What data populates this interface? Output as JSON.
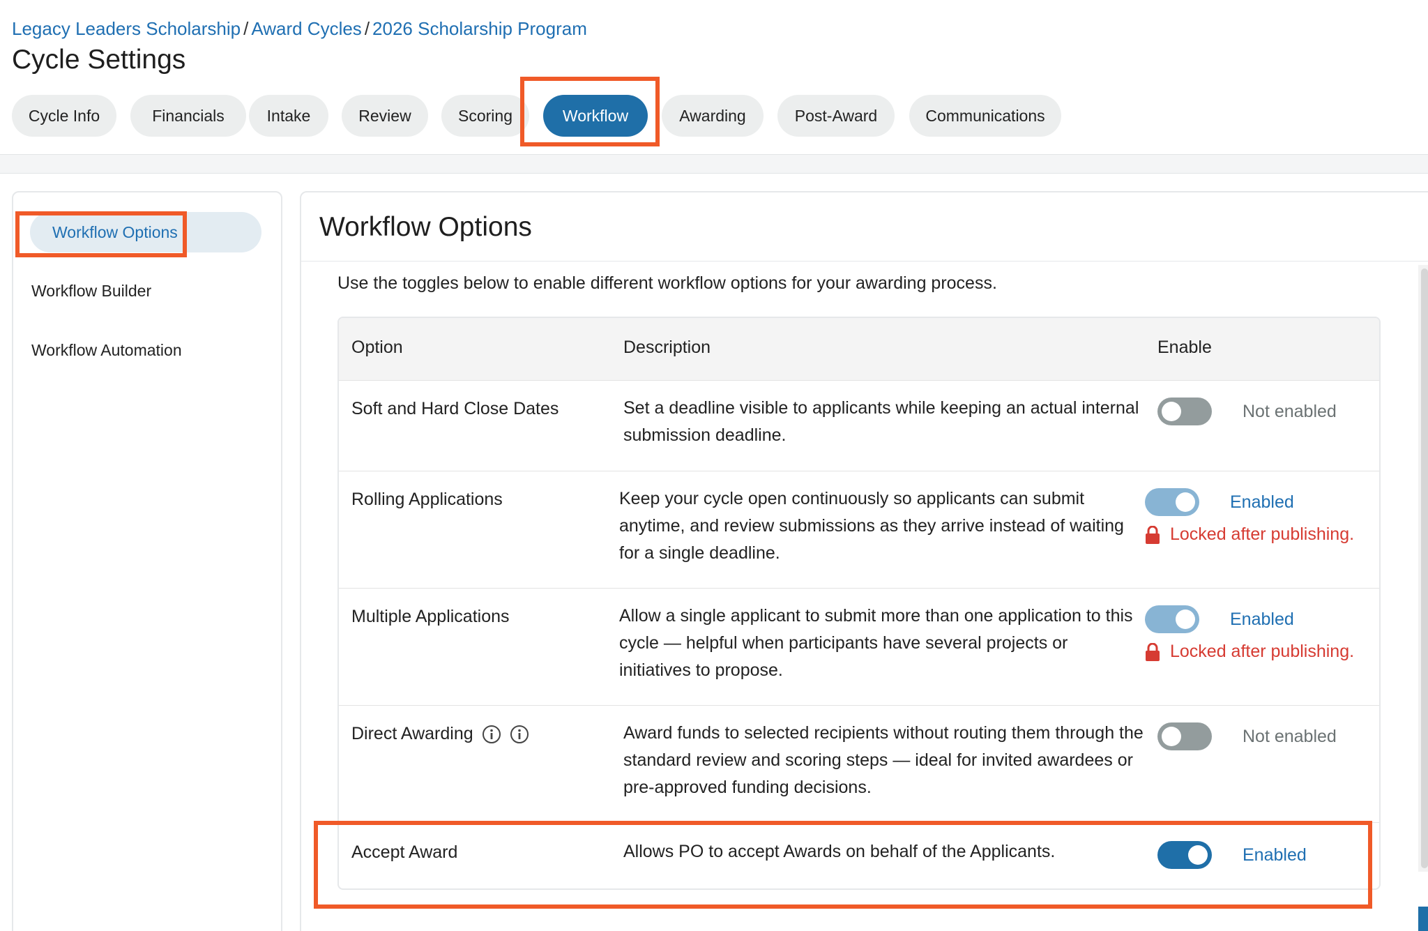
{
  "breadcrumb": {
    "items": [
      "Legacy Leaders Scholarship",
      "Award Cycles",
      "2026 Scholarship Program"
    ],
    "separator": "/"
  },
  "page_title": "Cycle Settings",
  "tabs": [
    {
      "label": "Cycle Info",
      "active": false
    },
    {
      "label": "Financials",
      "active": false
    },
    {
      "label": "Intake",
      "active": false
    },
    {
      "label": "Review",
      "active": false
    },
    {
      "label": "Scoring",
      "active": false
    },
    {
      "label": "Workflow",
      "active": true
    },
    {
      "label": "Awarding",
      "active": false
    },
    {
      "label": "Post-Award",
      "active": false
    },
    {
      "label": "Communications",
      "active": false
    }
  ],
  "sidebar": {
    "items": [
      {
        "label": "Workflow Options",
        "active": true
      },
      {
        "label": "Workflow Builder",
        "active": false
      },
      {
        "label": "Workflow Automation",
        "active": false
      }
    ]
  },
  "main": {
    "title": "Workflow Options",
    "intro": "Use the toggles below to enable different workflow options for your awarding process.",
    "table": {
      "headers": {
        "option": "Option",
        "description": "Description",
        "enable": "Enable"
      },
      "rows": [
        {
          "option": "Soft and Hard Close Dates",
          "description": "Set a deadline visible to applicants while keeping an actual internal submission deadline.",
          "enabled": false,
          "status": "Not enabled",
          "locked_note": ""
        },
        {
          "option": "Rolling Applications",
          "description": "Keep your cycle open continuously so applicants can submit anytime, and review submissions as they arrive instead of waiting for a single deadline.",
          "enabled": true,
          "status": "Enabled",
          "locked_note": "Locked after publishing."
        },
        {
          "option": "Multiple Applications",
          "description": "Allow a single applicant to submit more than one application to this cycle — helpful when participants have several projects or initiatives to propose.",
          "enabled": true,
          "status": "Enabled",
          "locked_note": "Locked after publishing."
        },
        {
          "option": "Direct Awarding",
          "description": "Award funds to selected recipients without routing them through the standard review and scoring steps — ideal for invited awardees or pre-approved funding decisions.",
          "enabled": false,
          "status": "Not enabled",
          "locked_note": "",
          "icons": [
            "info-icon",
            "info-icon"
          ]
        },
        {
          "option": "Accept Award",
          "description": "Allows PO to accept Awards on behalf of the Applicants.",
          "enabled": true,
          "status": "Enabled",
          "locked_note": ""
        }
      ]
    }
  },
  "colors": {
    "accent": "#1f6fa8",
    "link": "#1f6fb2",
    "highlight": "#f05a28",
    "locked": "#d63b32"
  }
}
